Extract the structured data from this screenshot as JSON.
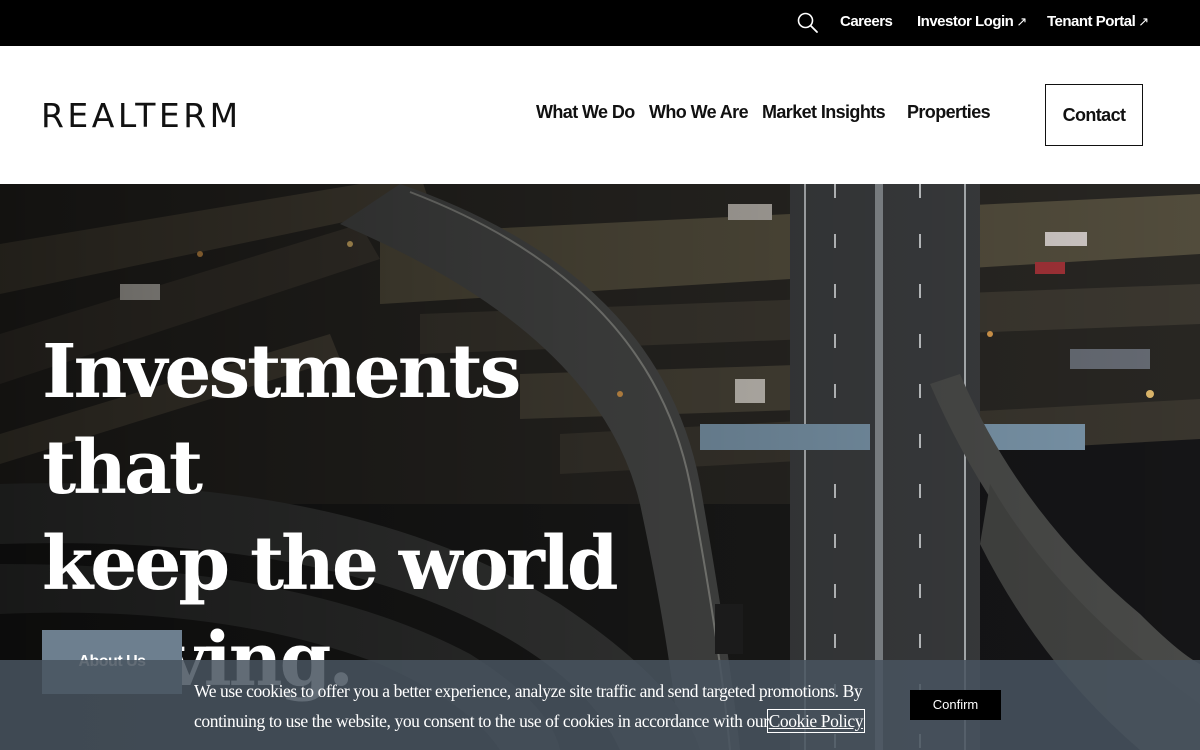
{
  "utility_bar": {
    "search_icon": "search-icon",
    "links": [
      {
        "label": "Careers"
      },
      {
        "label": "Investor Login",
        "external_icon": "↗"
      },
      {
        "label": "Tenant Portal",
        "external_icon": "↗"
      }
    ]
  },
  "header": {
    "logo": "REALTERM",
    "nav": [
      {
        "label": "What We Do"
      },
      {
        "label": "Who We Are"
      },
      {
        "label": "Market Insights"
      },
      {
        "label": "Properties"
      }
    ],
    "contact_label": "Contact"
  },
  "hero": {
    "title_lines": [
      "Investments that",
      "keep the world",
      "moving."
    ],
    "button_label": "About Us"
  },
  "cookie_banner": {
    "text": "We use cookies to offer you a better experience, analyze site traffic and send targeted promotions. By continuing to use the website, you consent to the use of cookies in accordance with our",
    "link_label": "Cookie Policy",
    "confirm_label": "Confirm"
  },
  "colors": {
    "utility_bar_bg": "#000000",
    "hero_button_bg": "#6d7f8f",
    "cookie_banner_bg": "#485460",
    "confirm_bg": "#000000"
  }
}
